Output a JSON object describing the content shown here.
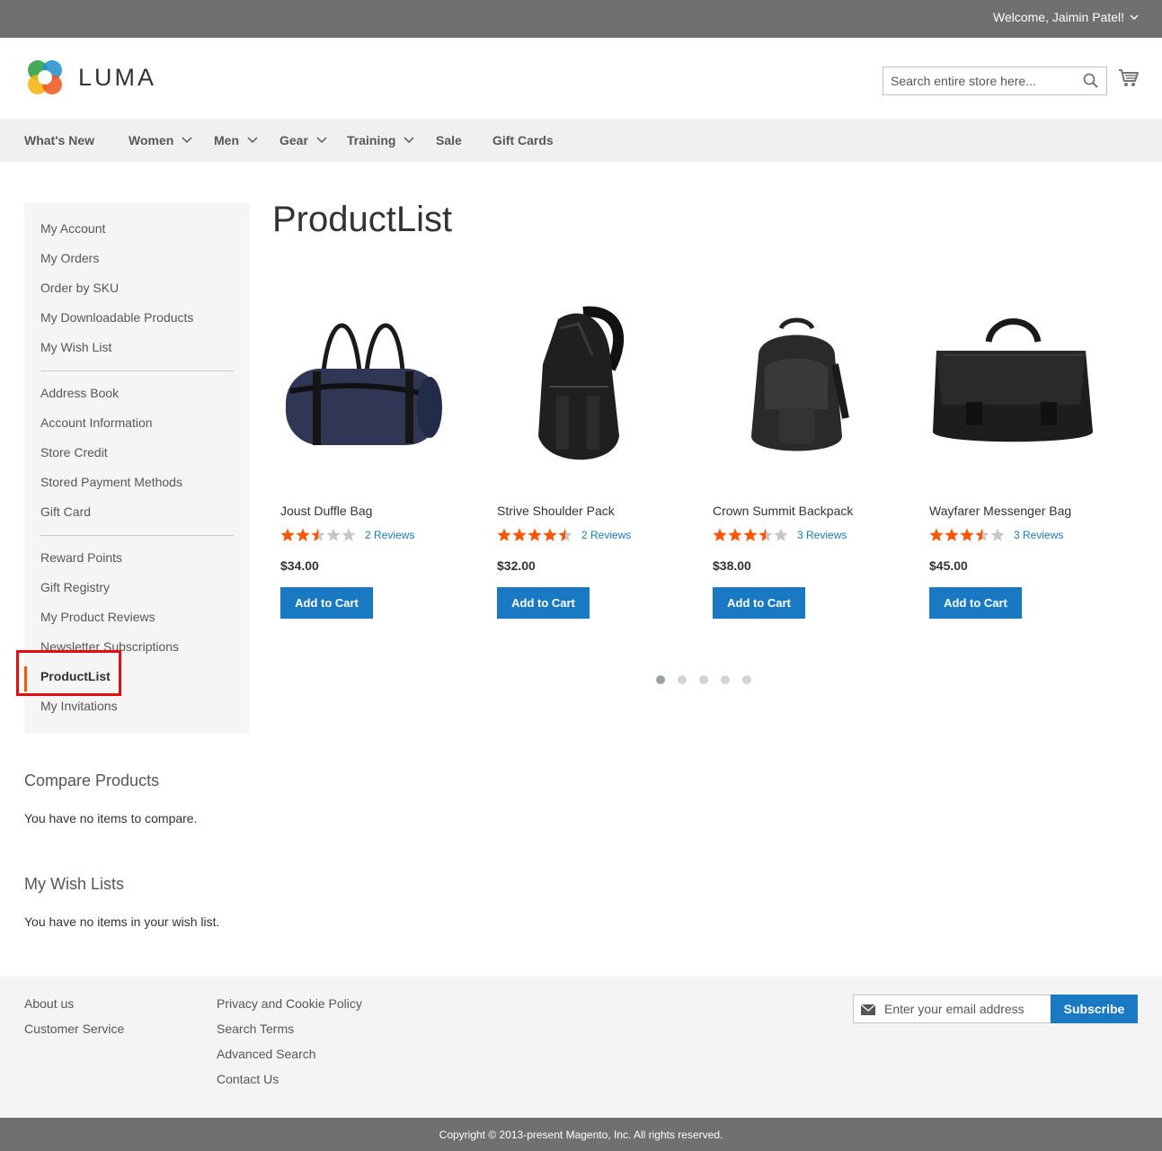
{
  "topbar": {
    "welcome": "Welcome, Jaimin Patel!"
  },
  "header": {
    "logo_text": "LUMA",
    "search_placeholder": "Search entire store here...",
    "icons": {
      "search": "search-icon",
      "cart": "cart-icon"
    }
  },
  "nav": [
    {
      "label": "What's New"
    },
    {
      "label": "Women"
    },
    {
      "label": "Men"
    },
    {
      "label": "Gear"
    },
    {
      "label": "Training"
    },
    {
      "label": "Sale"
    },
    {
      "label": "Gift Cards"
    }
  ],
  "sidebar": {
    "items": [
      "My Account",
      "My Orders",
      "Order by SKU",
      "My Downloadable Products",
      "My Wish List",
      "Address Book",
      "Account Information",
      "Store Credit",
      "Stored Payment Methods",
      "Gift Card",
      "Reward Points",
      "Gift Registry",
      "My Product Reviews",
      "Newsletter Subscriptions",
      "ProductList",
      "My Invitations"
    ],
    "current": "ProductList"
  },
  "main": {
    "title": "ProductList",
    "products": [
      {
        "name": "Joust Duffle Bag",
        "rating": 2.5,
        "reviews": "2 Reviews",
        "price": "$34.00",
        "button": "Add to Cart"
      },
      {
        "name": "Strive Shoulder Pack",
        "rating": 4.5,
        "reviews": "2 Reviews",
        "price": "$32.00",
        "button": "Add to Cart"
      },
      {
        "name": "Crown Summit Backpack",
        "rating": 3.5,
        "reviews": "3 Reviews",
        "price": "$38.00",
        "button": "Add to Cart"
      },
      {
        "name": "Wayfarer Messenger Bag",
        "rating": 3.5,
        "reviews": "3 Reviews",
        "price": "$45.00",
        "button": "Add to Cart"
      }
    ],
    "carousel": {
      "pages": 5,
      "active": 1
    }
  },
  "compare": {
    "title": "Compare Products",
    "text": "You have no items to compare."
  },
  "wishlist": {
    "title": "My Wish Lists",
    "text": "You have no items in your wish list."
  },
  "footer": {
    "col1": [
      "About us",
      "Customer Service"
    ],
    "col2": [
      "Privacy and Cookie Policy",
      "Search Terms",
      "Advanced Search",
      "Contact Us"
    ],
    "newsletter_placeholder": "Enter your email address",
    "subscribe": "Subscribe"
  },
  "copyright": "Copyright © 2013-present Magento, Inc. All rights reserved.",
  "colors": {
    "accent": "#1979c3",
    "star": "#ff5501",
    "topbar": "#6e716e"
  }
}
